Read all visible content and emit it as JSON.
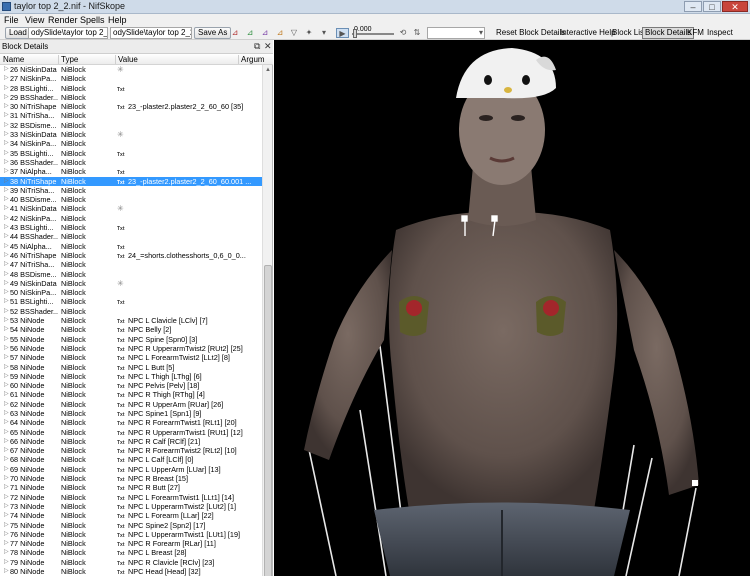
{
  "window": {
    "title": "taylor top 2_2.nif - NifSkope",
    "minimize": "‒",
    "maximize": "□",
    "close": "✕"
  },
  "menu": [
    "File",
    "View",
    "Render",
    "Spells",
    "Help"
  ],
  "toolbar": {
    "load_label": "Load",
    "load_path": "odySlide\\taylor top 2_2.nif",
    "save_path": "odySlide\\taylor top 2_2.nif",
    "save_as_label": "Save As",
    "time_value": "0.000",
    "reset_block_details": "Reset Block Details",
    "interactive_help": "Interactive Help",
    "block_list": "Block List",
    "block_details": "Block Details",
    "kfm": "KFM",
    "inspect": "Inspect"
  },
  "panel": {
    "title": "Block Details",
    "columns": [
      "Name",
      "Type",
      "Value",
      "Argum"
    ],
    "rows": [
      {
        "name": "26 NiSkinData",
        "type": "NiBlock",
        "value": "",
        "icon": "mesh"
      },
      {
        "name": "27 NiSkinPa...",
        "type": "NiBlock",
        "value": "",
        "icon": ""
      },
      {
        "name": "28 BSLighti...",
        "type": "NiBlock",
        "value": "",
        "icon": "txt"
      },
      {
        "name": "29 BSShader...",
        "type": "NiBlock",
        "value": "",
        "icon": ""
      },
      {
        "name": "30 NiTriShape",
        "type": "NiBlock",
        "value": "23_-plaster2.plaster2_2_60_60 [35]",
        "icon": "txt"
      },
      {
        "name": "31 NiTriSha...",
        "type": "NiBlock",
        "value": "",
        "icon": ""
      },
      {
        "name": "32 BSDisme...",
        "type": "NiBlock",
        "value": "",
        "icon": ""
      },
      {
        "name": "33 NiSkinData",
        "type": "NiBlock",
        "value": "",
        "icon": "mesh"
      },
      {
        "name": "34 NiSkinPa...",
        "type": "NiBlock",
        "value": "",
        "icon": ""
      },
      {
        "name": "35 BSLighti...",
        "type": "NiBlock",
        "value": "",
        "icon": "txt"
      },
      {
        "name": "36 BSShader...",
        "type": "NiBlock",
        "value": "",
        "icon": ""
      },
      {
        "name": "37 NiAlpha...",
        "type": "NiBlock",
        "value": "",
        "icon": "txt"
      },
      {
        "name": "38 NiTriShape",
        "type": "NiBlock",
        "value": "23_-plaster2.plaster2_2_60_60.001 ...",
        "icon": "txt",
        "selected": true
      },
      {
        "name": "39 NiTriSha...",
        "type": "NiBlock",
        "value": "",
        "icon": ""
      },
      {
        "name": "40 BSDisme...",
        "type": "NiBlock",
        "value": "",
        "icon": ""
      },
      {
        "name": "41 NiSkinData",
        "type": "NiBlock",
        "value": "",
        "icon": "mesh"
      },
      {
        "name": "42 NiSkinPa...",
        "type": "NiBlock",
        "value": "",
        "icon": ""
      },
      {
        "name": "43 BSLighti...",
        "type": "NiBlock",
        "value": "",
        "icon": "txt"
      },
      {
        "name": "44 BSShader...",
        "type": "NiBlock",
        "value": "",
        "icon": ""
      },
      {
        "name": "45 NiAlpha...",
        "type": "NiBlock",
        "value": "",
        "icon": "txt"
      },
      {
        "name": "46 NiTriShape",
        "type": "NiBlock",
        "value": "24_=shorts.clothesshorts_0,6_0_0...",
        "icon": "txt"
      },
      {
        "name": "47 NiTriSha...",
        "type": "NiBlock",
        "value": "",
        "icon": ""
      },
      {
        "name": "48 BSDisme...",
        "type": "NiBlock",
        "value": "",
        "icon": ""
      },
      {
        "name": "49 NiSkinData",
        "type": "NiBlock",
        "value": "",
        "icon": "mesh"
      },
      {
        "name": "50 NiSkinPa...",
        "type": "NiBlock",
        "value": "",
        "icon": ""
      },
      {
        "name": "51 BSLighti...",
        "type": "NiBlock",
        "value": "",
        "icon": "txt"
      },
      {
        "name": "52 BSShader...",
        "type": "NiBlock",
        "value": "",
        "icon": ""
      },
      {
        "name": "53 NiNode",
        "type": "NiBlock",
        "value": "NPC L Clavicle [LClv] [7]",
        "icon": "txt"
      },
      {
        "name": "54 NiNode",
        "type": "NiBlock",
        "value": "NPC Belly [2]",
        "icon": "txt"
      },
      {
        "name": "55 NiNode",
        "type": "NiBlock",
        "value": "NPC Spine [Spn0] [3]",
        "icon": "txt"
      },
      {
        "name": "56 NiNode",
        "type": "NiBlock",
        "value": "NPC R UpperarmTwist2 [RUt2] [25]",
        "icon": "txt"
      },
      {
        "name": "57 NiNode",
        "type": "NiBlock",
        "value": "NPC L ForearmTwist2 [LLt2] [8]",
        "icon": "txt"
      },
      {
        "name": "58 NiNode",
        "type": "NiBlock",
        "value": "NPC L Butt [5]",
        "icon": "txt"
      },
      {
        "name": "59 NiNode",
        "type": "NiBlock",
        "value": "NPC L Thigh [LThg] [6]",
        "icon": "txt"
      },
      {
        "name": "60 NiNode",
        "type": "NiBlock",
        "value": "NPC Pelvis [Pelv] [18]",
        "icon": "txt"
      },
      {
        "name": "61 NiNode",
        "type": "NiBlock",
        "value": "NPC R Thigh [RThg] [4]",
        "icon": "txt"
      },
      {
        "name": "62 NiNode",
        "type": "NiBlock",
        "value": "NPC R UpperArm [RUar] [26]",
        "icon": "txt"
      },
      {
        "name": "63 NiNode",
        "type": "NiBlock",
        "value": "NPC Spine1 [Spn1] [9]",
        "icon": "txt"
      },
      {
        "name": "64 NiNode",
        "type": "NiBlock",
        "value": "NPC R ForearmTwist1 [RLt1] [20]",
        "icon": "txt"
      },
      {
        "name": "65 NiNode",
        "type": "NiBlock",
        "value": "NPC R UpperarmTwist1 [RUt1] [12]",
        "icon": "txt"
      },
      {
        "name": "66 NiNode",
        "type": "NiBlock",
        "value": "NPC R Calf [RClf] [21]",
        "icon": "txt"
      },
      {
        "name": "67 NiNode",
        "type": "NiBlock",
        "value": "NPC R ForearmTwist2 [RLt2] [10]",
        "icon": "txt"
      },
      {
        "name": "68 NiNode",
        "type": "NiBlock",
        "value": "NPC L Calf [LClf] [0]",
        "icon": "txt"
      },
      {
        "name": "69 NiNode",
        "type": "NiBlock",
        "value": "NPC L UpperArm [LUar] [13]",
        "icon": "txt"
      },
      {
        "name": "70 NiNode",
        "type": "NiBlock",
        "value": "NPC R Breast [15]",
        "icon": "txt"
      },
      {
        "name": "71 NiNode",
        "type": "NiBlock",
        "value": "NPC R Butt [27]",
        "icon": "txt"
      },
      {
        "name": "72 NiNode",
        "type": "NiBlock",
        "value": "NPC L ForearmTwist1 [LLt1] [14]",
        "icon": "txt"
      },
      {
        "name": "73 NiNode",
        "type": "NiBlock",
        "value": "NPC L UpperarmTwist2 [LUt2] [1]",
        "icon": "txt"
      },
      {
        "name": "74 NiNode",
        "type": "NiBlock",
        "value": "NPC L Forearm [LLar] [22]",
        "icon": "txt"
      },
      {
        "name": "75 NiNode",
        "type": "NiBlock",
        "value": "NPC Spine2 [Spn2] [17]",
        "icon": "txt"
      },
      {
        "name": "76 NiNode",
        "type": "NiBlock",
        "value": "NPC L UpperarmTwist1 [LUt1] [19]",
        "icon": "txt"
      },
      {
        "name": "77 NiNode",
        "type": "NiBlock",
        "value": "NPC R Forearm [RLar] [11]",
        "icon": "txt"
      },
      {
        "name": "78 NiNode",
        "type": "NiBlock",
        "value": "NPC L Breast [28]",
        "icon": "txt"
      },
      {
        "name": "79 NiNode",
        "type": "NiBlock",
        "value": "NPC R Clavicle [RClv] [23]",
        "icon": "txt"
      },
      {
        "name": "80 NiNode",
        "type": "NiBlock",
        "value": "NPC Head [Head] [32]",
        "icon": "txt"
      },
      {
        "name": "NiFooter",
        "type": "Footer",
        "value": "",
        "icon": ""
      }
    ]
  },
  "icons": {
    "txt_glyph": "Txt",
    "mesh_glyph": "✳"
  },
  "colors": {
    "selection": "#3399ff",
    "viewport_bg": "#000000"
  }
}
